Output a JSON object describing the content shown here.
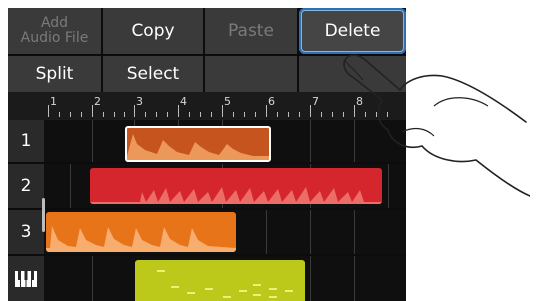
{
  "toolbar": {
    "add_audio_file": "Add\nAudio File",
    "copy": "Copy",
    "paste": "Paste",
    "delete": "Delete",
    "split": "Split",
    "select": "Select"
  },
  "ruler": {
    "bars": [
      "2",
      "3",
      "4",
      "5",
      "6",
      "7",
      "8"
    ]
  },
  "tracks": [
    {
      "label": "1",
      "region_color": "#c6541e"
    },
    {
      "label": "2",
      "region_color": "#d6262d"
    },
    {
      "label": "3",
      "region_color": "#e8741a"
    },
    {
      "label": "",
      "region_color": "#bcc91a",
      "icon": "piano-keys-icon"
    }
  ]
}
